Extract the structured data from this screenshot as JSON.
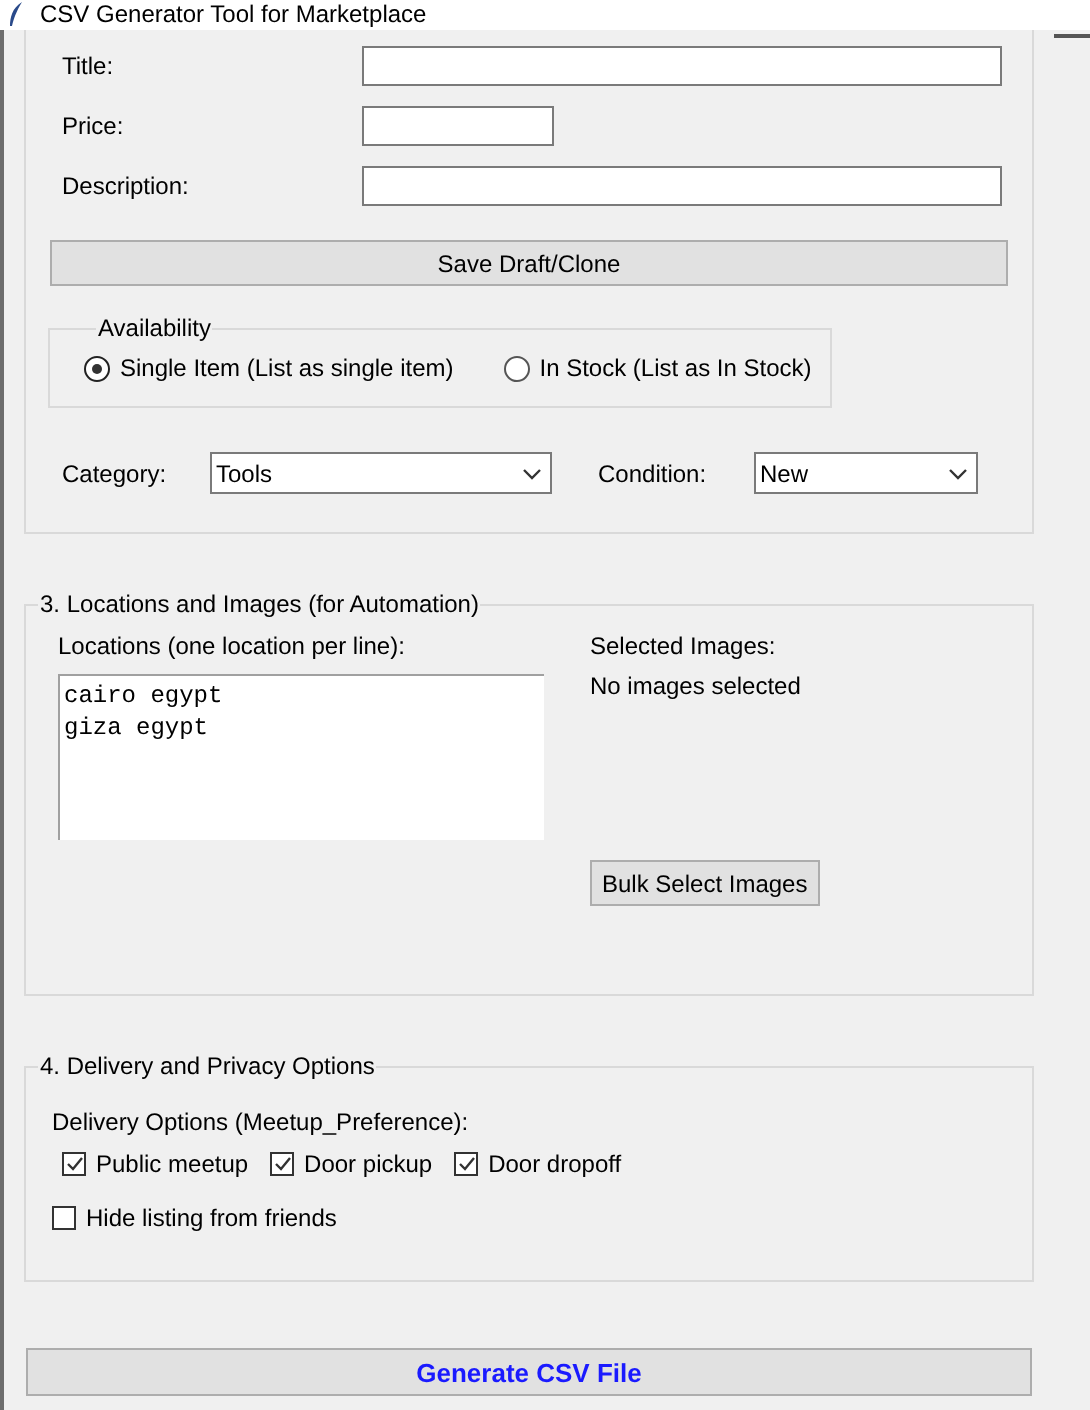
{
  "window": {
    "title": "CSV Generator Tool for Marketplace"
  },
  "details": {
    "fields": [
      {
        "label": "Title:",
        "kind": "wide"
      },
      {
        "label": "Price:",
        "kind": "short"
      },
      {
        "label": "Description:",
        "kind": "wide"
      }
    ],
    "save_button": "Save Draft/Clone",
    "availability": {
      "title": "Availability",
      "options": [
        {
          "label": "Single Item (List as single item)",
          "selected": true
        },
        {
          "label": "In Stock (List as In Stock)",
          "selected": false
        }
      ]
    },
    "selects": [
      {
        "label": "Category:",
        "value": "Tools",
        "kind": "wide"
      },
      {
        "label": "Condition:",
        "value": "New",
        "kind": "short"
      }
    ]
  },
  "locations_section": {
    "title": "3. Locations and Images (for Automation)",
    "locations_label": "Locations (one location per line):",
    "locations": [
      "cairo egypt",
      "giza egypt"
    ],
    "images_label": "Selected Images:",
    "images_status": "No images selected",
    "bulk_button": "Bulk Select Images"
  },
  "delivery_section": {
    "title": "4. Delivery and Privacy Options",
    "options_label": "Delivery Options (Meetup_Preference):",
    "options": [
      {
        "label": "Public meetup",
        "checked": true
      },
      {
        "label": "Door pickup",
        "checked": true
      },
      {
        "label": "Door dropoff",
        "checked": true
      }
    ],
    "hide": {
      "label": "Hide listing from friends",
      "checked": false
    }
  },
  "generate_button": "Generate CSV File"
}
